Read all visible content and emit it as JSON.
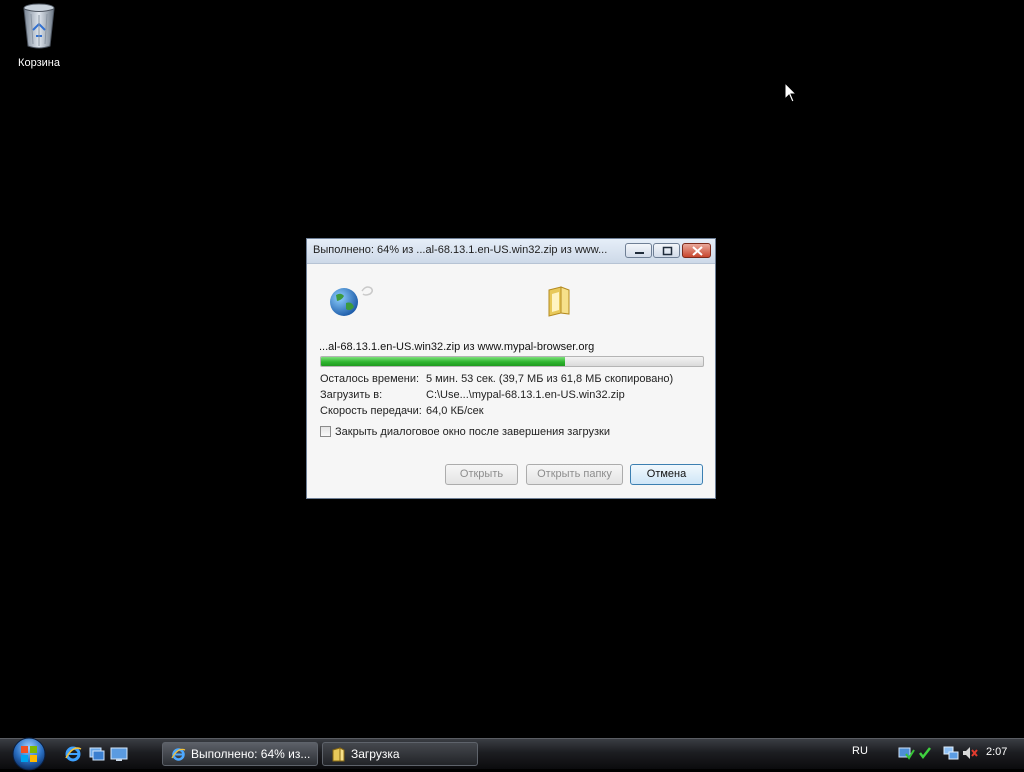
{
  "desktop": {
    "recycle_bin_label": "Корзина"
  },
  "dialog": {
    "title": "Выполнено: 64% из ...al-68.13.1.en-US.win32.zip из www...",
    "filename": "...al-68.13.1.en-US.win32.zip из www.mypal-browser.org",
    "progress_percent": 64,
    "time_left_label": "Осталось времени:",
    "time_left_value": "5 мин. 53 сек. (39,7 МБ из 61,8 МБ скопировано)",
    "save_to_label": "Загрузить в:",
    "save_to_value": "C:\\Use...\\mypal-68.13.1.en-US.win32.zip",
    "speed_label": "Скорость передачи:",
    "speed_value": "64,0 КБ/сек",
    "close_checkbox_label": "Закрыть диалоговое окно после завершения загрузки",
    "close_checkbox_checked": false,
    "open_button": "Открыть",
    "open_folder_button": "Открыть папку",
    "cancel_button": "Отмена"
  },
  "taskbar": {
    "tasks": [
      {
        "label": "Выполнено: 64% из..."
      },
      {
        "label": "Загрузка"
      }
    ],
    "language": "RU",
    "clock": "2:07"
  },
  "colors": {
    "desktop_bg": "#000000",
    "progress_fill": "#2fb52f"
  }
}
